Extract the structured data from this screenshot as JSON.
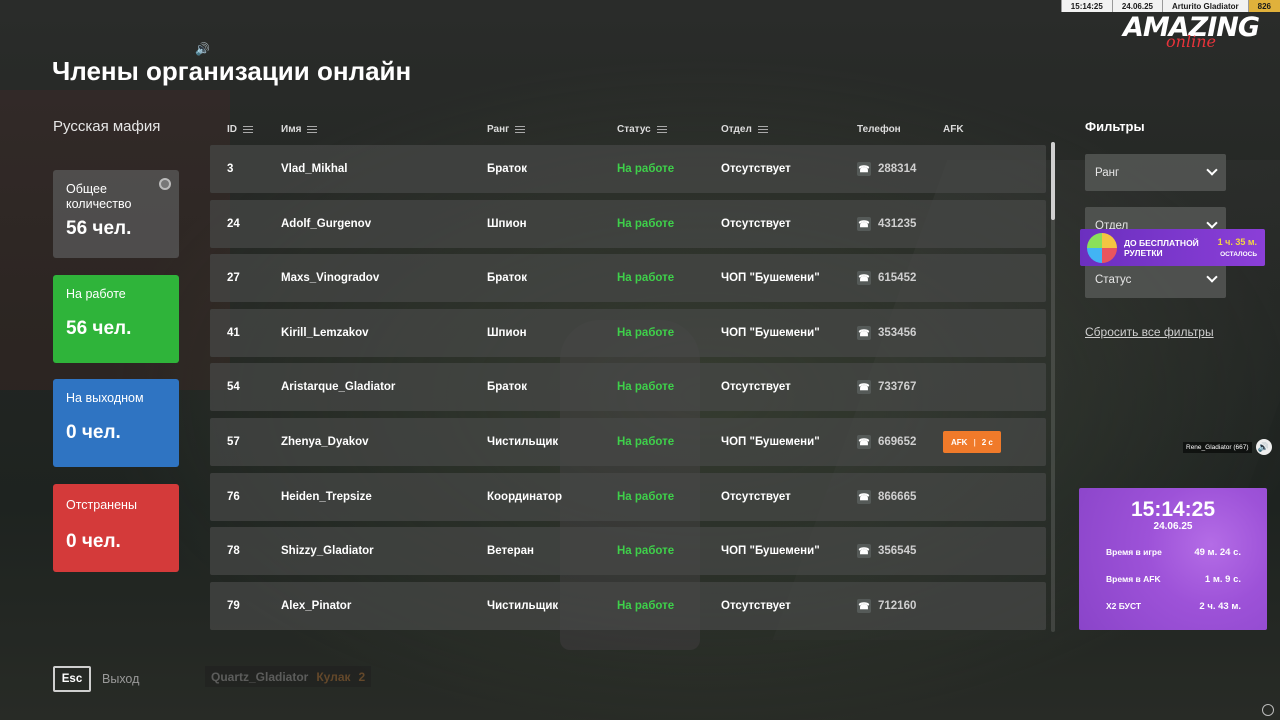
{
  "hud": {
    "time": "15:14:25",
    "date": "24.06.25",
    "player": "Arturito Gladiator",
    "id": "826"
  },
  "logo": {
    "main": "AMAZING",
    "sub": "online"
  },
  "page_title": "Члены организации онлайн",
  "org_name": "Русская мафия",
  "stats": {
    "total": {
      "label": "Общее количество",
      "value": "56 чел."
    },
    "working": {
      "label": "На работе",
      "value": "56 чел."
    },
    "off": {
      "label": "На выходном",
      "value": "0 чел."
    },
    "suspended": {
      "label": "Отстранены",
      "value": "0 чел."
    }
  },
  "colors": {
    "working": "#2fb43a",
    "off": "#2f74c2",
    "suspended": "#d43a3a",
    "status_text": "#3ed04a",
    "afk": "#f07a2a",
    "panel_purple": "#9d52d8"
  },
  "table": {
    "headers": {
      "id": "ID",
      "name": "Имя",
      "rank": "Ранг",
      "status": "Статус",
      "dept": "Отдел",
      "phone": "Телефон",
      "afk": "AFK"
    },
    "rows": [
      {
        "id": "3",
        "name": "Vlad_Mikhal",
        "rank": "Браток",
        "status": "На работе",
        "dept": "Отсутствует",
        "phone": "288314",
        "afk": ""
      },
      {
        "id": "24",
        "name": "Adolf_Gurgenov",
        "rank": "Шпион",
        "status": "На работе",
        "dept": "Отсутствует",
        "phone": "431235",
        "afk": ""
      },
      {
        "id": "27",
        "name": "Maxs_Vinogradov",
        "rank": "Браток",
        "status": "На работе",
        "dept": "ЧОП \"Бушемени\"",
        "phone": "615452",
        "afk": ""
      },
      {
        "id": "41",
        "name": "Kirill_Lemzakov",
        "rank": "Шпион",
        "status": "На работе",
        "dept": "ЧОП \"Бушемени\"",
        "phone": "353456",
        "afk": ""
      },
      {
        "id": "54",
        "name": "Aristarque_Gladiator",
        "rank": "Браток",
        "status": "На работе",
        "dept": "Отсутствует",
        "phone": "733767",
        "afk": ""
      },
      {
        "id": "57",
        "name": "Zhenya_Dyakov",
        "rank": "Чистильщик",
        "status": "На работе",
        "dept": "ЧОП \"Бушемени\"",
        "phone": "669652",
        "afk": {
          "label": "AFK",
          "time": "2 с"
        }
      },
      {
        "id": "76",
        "name": "Heiden_Trepsize",
        "rank": "Координатор",
        "status": "На работе",
        "dept": "Отсутствует",
        "phone": "866665",
        "afk": ""
      },
      {
        "id": "78",
        "name": "Shizzy_Gladiator",
        "rank": "Ветеран",
        "status": "На работе",
        "dept": "ЧОП \"Бушемени\"",
        "phone": "356545",
        "afk": ""
      },
      {
        "id": "79",
        "name": "Alex_Pinator",
        "rank": "Чистильщик",
        "status": "На работе",
        "dept": "Отсутствует",
        "phone": "712160",
        "afk": ""
      }
    ]
  },
  "filters": {
    "title": "Фильтры",
    "rank": "Ранг",
    "dept": "Отдел",
    "status": "Статус",
    "reset": "Сбросить все фильтры"
  },
  "roulette": {
    "text": "ДО БЕСПЛАТНОЙ РУЛЕТКИ",
    "time": "1 ч. 35 м.",
    "left": "ОСТАЛОСЬ"
  },
  "player_tag": "Rene_Gladiator (667)",
  "time_panel": {
    "clock": "15:14:25",
    "date": "24.06.25",
    "game_time_label": "Время в игре",
    "game_time": "49 м. 24 с.",
    "afk_time_label": "Время в AFK",
    "afk_time": "1 м. 9 с.",
    "boost_label": "X2 БУСТ",
    "boost": "2 ч. 43 м."
  },
  "footer": {
    "esc": "Esc",
    "exit": "Выход"
  },
  "bottom_player": {
    "name": "Quartz_Gladiator",
    "rank": "Кулак",
    "num": "2"
  }
}
